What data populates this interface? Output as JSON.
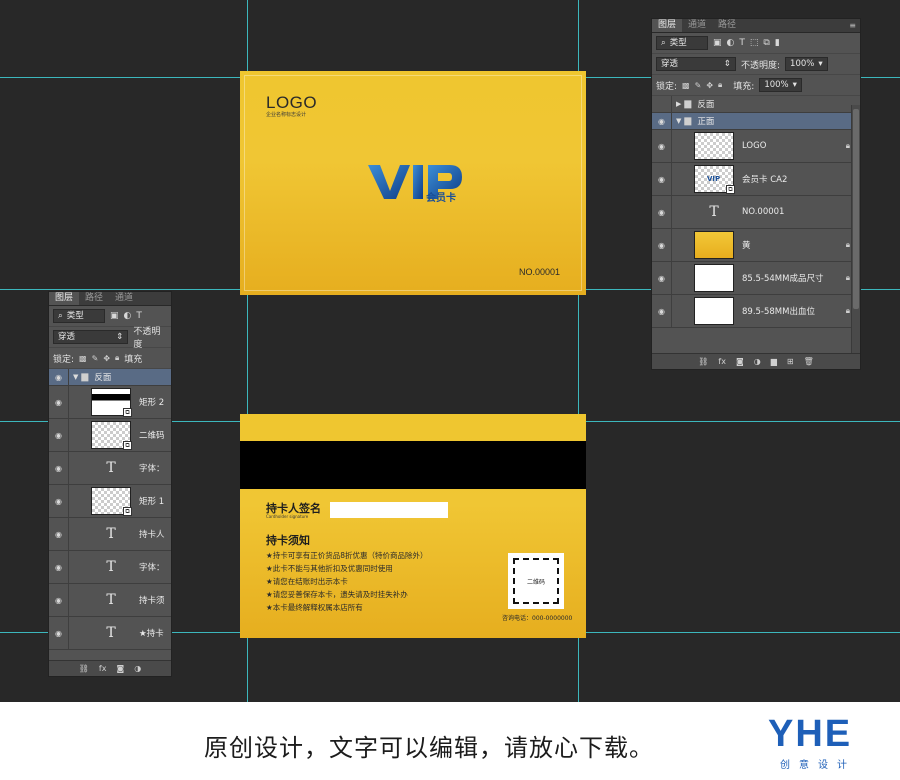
{
  "front_card": {
    "logo": "LOGO",
    "logo_sub": "企业名称标志设计",
    "vip_text": "VIP",
    "vip_sub": "会员卡",
    "card_number": "NO.00001"
  },
  "back_card": {
    "signature_label": "持卡人签名",
    "signature_sub": "Cardholder signature",
    "notice_title": "持卡须知",
    "notices": [
      "★持卡可享有正价货品8折优惠（特价商品除外）",
      "★此卡不能与其他折扣及优惠同时使用",
      "★请您在结账时出示本卡",
      "★请您妥善保存本卡，遗失请及时挂失补办",
      "★本卡最终解释权属本店所有"
    ],
    "qr_label": "二维码",
    "phone": "咨询电话：000-0000000"
  },
  "right_panel": {
    "tabs": [
      "图层",
      "通道",
      "路径"
    ],
    "filter_kind": "类型",
    "blend_mode": "穿透",
    "opacity_label": "不透明度:",
    "opacity_value": "100%",
    "lock_label": "锁定:",
    "fill_label": "填充:",
    "fill_value": "100%",
    "layers": [
      {
        "name": "反面",
        "kind": "group",
        "visible": false,
        "selected": false
      },
      {
        "name": "正面",
        "kind": "group",
        "visible": true,
        "selected": true
      },
      {
        "name": "LOGO",
        "kind": "image",
        "locked": true
      },
      {
        "name": "会员卡 CA2",
        "kind": "smart"
      },
      {
        "name": "NO.00001",
        "kind": "text"
      },
      {
        "name": "黄",
        "kind": "fill",
        "locked": true
      },
      {
        "name": "85.5-54MM成品尺寸",
        "kind": "white",
        "locked": true
      },
      {
        "name": "89.5-58MM出血位",
        "kind": "white",
        "locked": true
      }
    ]
  },
  "left_panel": {
    "tabs": [
      "图层",
      "路径",
      "通道"
    ],
    "filter_kind": "类型",
    "blend_mode": "穿透",
    "opacity_label": "不透明度",
    "lock_label": "锁定:",
    "fill_label": "填充",
    "layers": [
      {
        "name": "反面",
        "kind": "group"
      },
      {
        "name": "矩形 2",
        "kind": "stripe"
      },
      {
        "name": "二维码",
        "kind": "smart"
      },
      {
        "name": "字体：",
        "kind": "text"
      },
      {
        "name": "矩形 1",
        "kind": "smart"
      },
      {
        "name": "持卡人",
        "kind": "text"
      },
      {
        "name": "字体：",
        "kind": "text"
      },
      {
        "name": "持卡须",
        "kind": "text"
      },
      {
        "name": "★持卡",
        "kind": "text"
      }
    ]
  },
  "caption": {
    "text": "原创设计，文字可以编辑，请放心下载。",
    "brand": "YHE",
    "brand_sub": "创意设计"
  },
  "colors": {
    "card_gold": "#efc62f",
    "brand_blue": "#1e5fb8",
    "guide_cyan": "#3fd0d6",
    "panel_gray": "#535353"
  }
}
